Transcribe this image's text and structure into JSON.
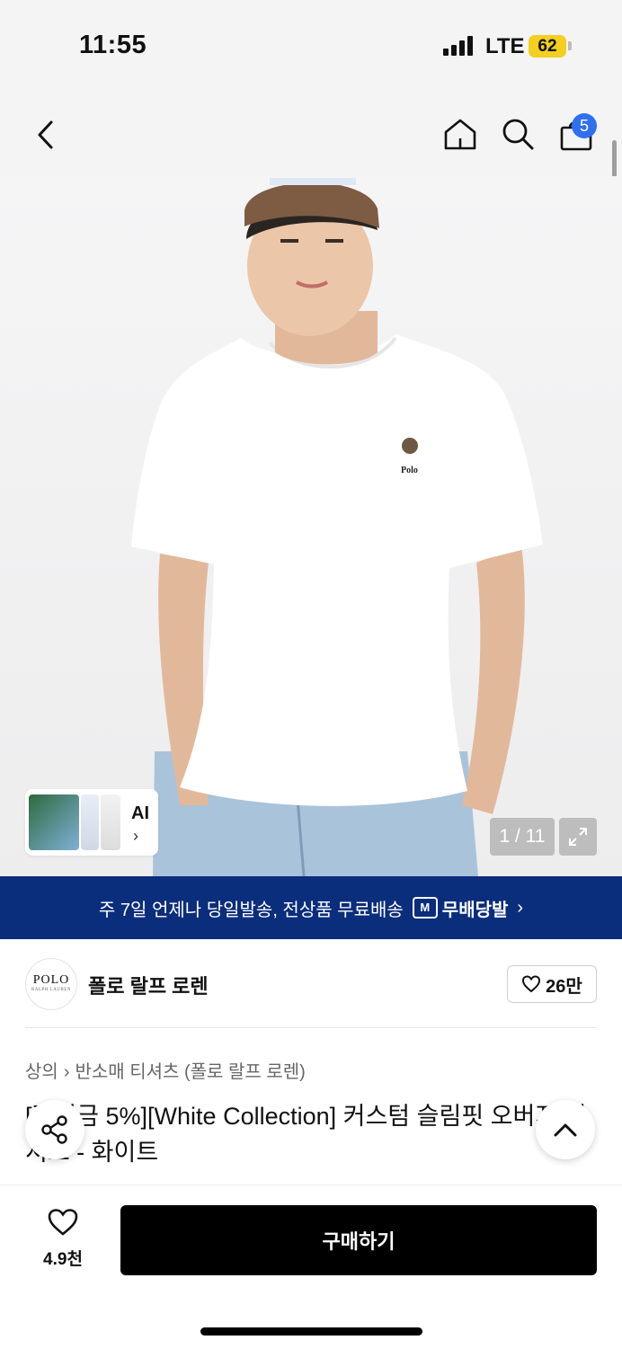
{
  "status": {
    "time": "11:55",
    "network": "LTE",
    "battery": "62"
  },
  "nav": {
    "cart_count": "5"
  },
  "gallery": {
    "ai_label": "AI",
    "pager": "1 / 11",
    "logo_text": "Polo"
  },
  "banner": {
    "text": "주 7일 언제나 당일발송, 전상품 무료배송",
    "service_badge": "M",
    "service_name": "무배당발"
  },
  "brand": {
    "logo_top": "POLO",
    "logo_bottom": "RALPH LAUREN",
    "name": "폴로 랄프 로렌",
    "likes": "26만"
  },
  "breadcrumb": {
    "level1": "상의",
    "level2": "반소매 티셔츠 (폴로 랄프 로렌)"
  },
  "product": {
    "title": "[적립금 5%][White Collection] 커스텀 슬림핏 오버지 티셔츠 - 화이트"
  },
  "bottom": {
    "wish_count": "4.9천",
    "buy_label": "구매하기"
  }
}
